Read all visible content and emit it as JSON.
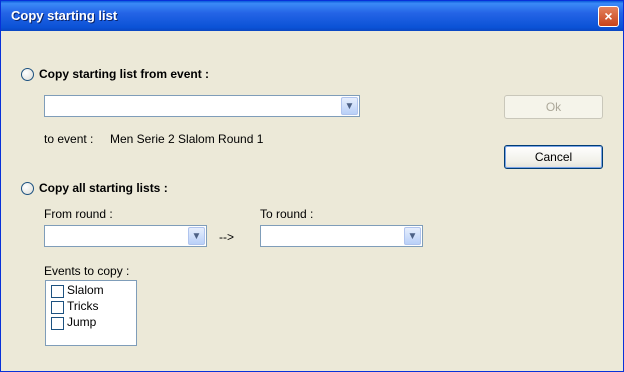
{
  "window": {
    "title": "Copy starting list",
    "close_glyph": "×"
  },
  "section1": {
    "radio_label": "Copy starting list from event :",
    "event_combo_value": "",
    "to_event_label": "to event :",
    "to_event_value": "Men Serie 2 Slalom Round 1"
  },
  "section2": {
    "radio_label": "Copy all starting lists :",
    "from_round_label": "From round :",
    "from_round_value": "",
    "arrow": "-->",
    "to_round_label": "To round :",
    "to_round_value": "",
    "events_label": "Events to copy :",
    "events": [
      {
        "label": "Slalom",
        "checked": false
      },
      {
        "label": "Tricks",
        "checked": false
      },
      {
        "label": "Jump",
        "checked": false
      }
    ]
  },
  "buttons": {
    "ok": "Ok",
    "cancel": "Cancel"
  },
  "icons": {
    "combo_arrow": "chevron-down-icon",
    "close": "close-icon"
  },
  "colors": {
    "titlebar": "#0A5BDB",
    "dialog_bg": "#ECE9D8",
    "border": "#7F9DB9"
  }
}
